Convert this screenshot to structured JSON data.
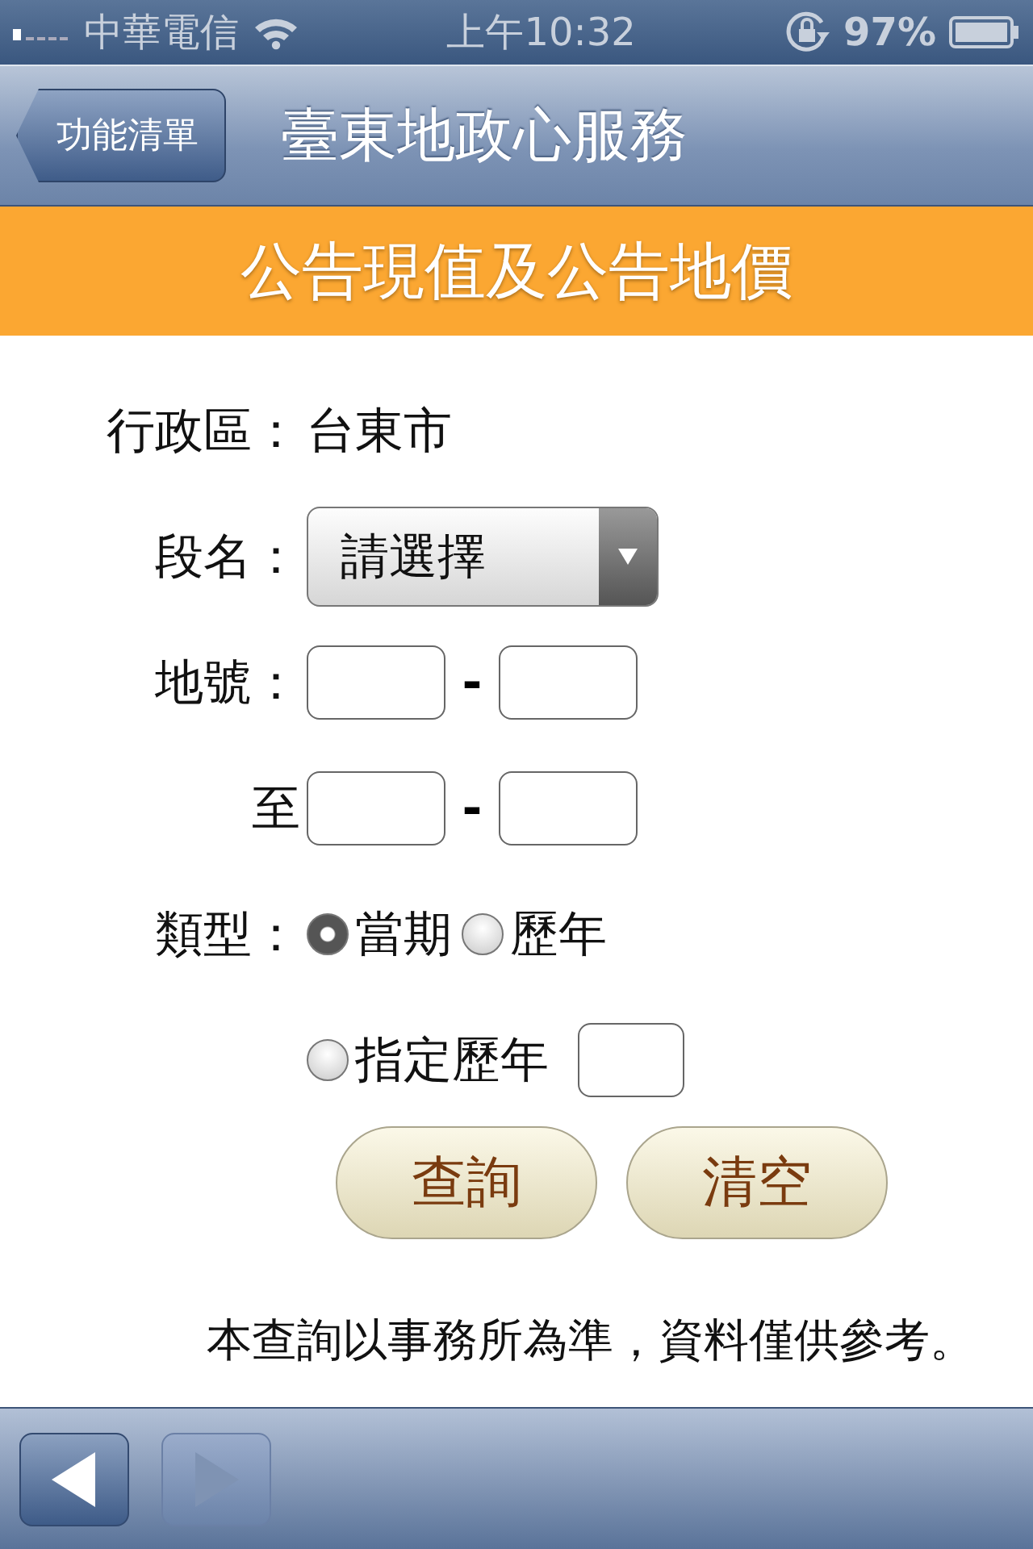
{
  "status_bar": {
    "carrier": "中華電信",
    "time": "上午10:32",
    "battery": "97%"
  },
  "nav_bar": {
    "back_button": "功能清單",
    "title": "臺東地政心服務"
  },
  "banner": "公告現值及公告地價",
  "form": {
    "district": {
      "label": "行政區：",
      "value": "台東市"
    },
    "section": {
      "label": "段名：",
      "value": "請選擇"
    },
    "lot_from": {
      "label": "地號：",
      "separator": "-"
    },
    "lot_to": {
      "label": "至",
      "separator": "-"
    },
    "type": {
      "label": "類型：",
      "options": [
        {
          "label": "當期",
          "selected": true,
          "kind": "plain"
        },
        {
          "label": "歷年",
          "selected": false,
          "kind": "plain"
        },
        {
          "label": "指定歷年",
          "selected": false,
          "kind": "with_year"
        }
      ]
    }
  },
  "buttons": [
    "查詢",
    "清空"
  ],
  "note": "本查詢以事務所為準，資料僅供參考。",
  "toolbar": [
    {
      "kind": "back",
      "disabled": false
    },
    {
      "kind": "forward",
      "disabled": true
    }
  ]
}
